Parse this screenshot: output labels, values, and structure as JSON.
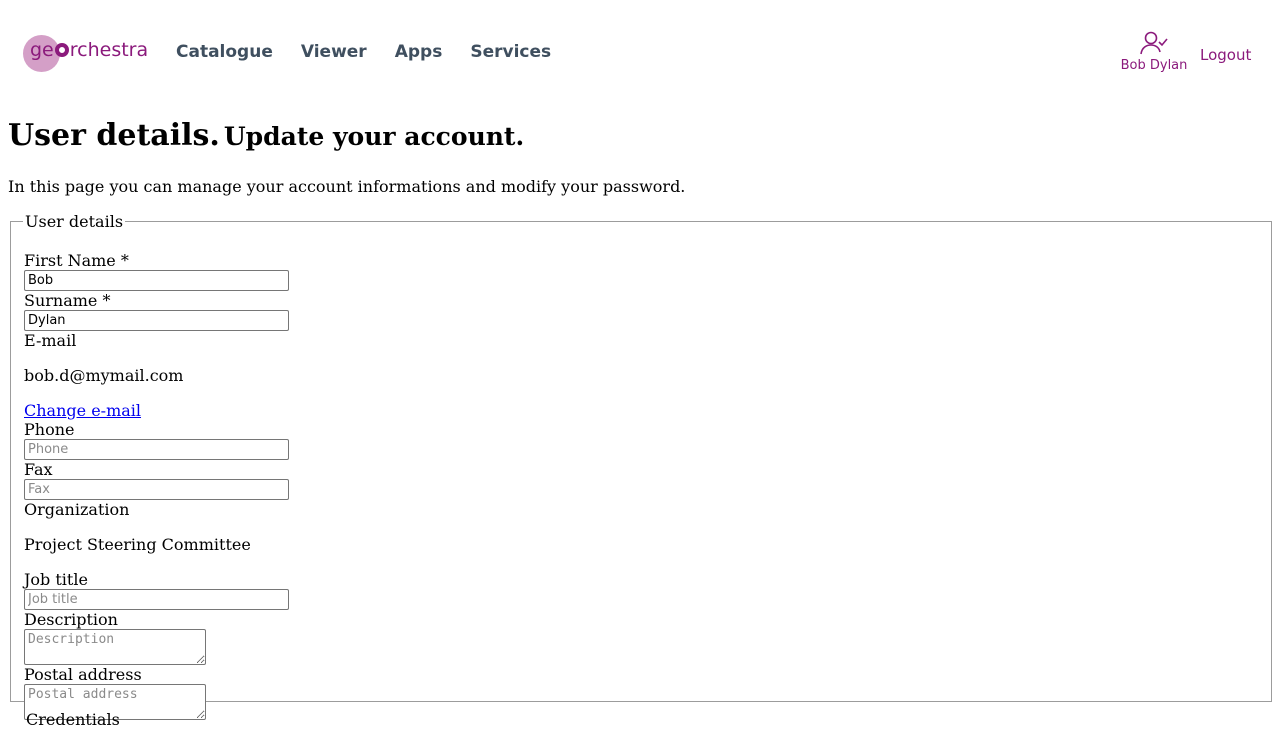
{
  "header": {
    "logo_text_pre": "ge",
    "logo_text_post": "rchestra",
    "nav": [
      "Catalogue",
      "Viewer",
      "Apps",
      "Services"
    ],
    "user_name": "Bob Dylan",
    "logout": "Logout"
  },
  "page": {
    "title": "User details.",
    "subtitle": "Update your account.",
    "intro": "In this page you can manage your account informations and modify your password."
  },
  "form": {
    "legend": "User details",
    "first_name_label": "First Name *",
    "first_name_value": "Bob",
    "surname_label": "Surname *",
    "surname_value": "Dylan",
    "email_label": "E-mail",
    "email_value": "bob.d@mymail.com",
    "change_email": "Change e-mail",
    "phone_label": "Phone",
    "phone_placeholder": "Phone",
    "fax_label": "Fax",
    "fax_placeholder": "Fax",
    "organization_label": "Organization",
    "organization_value": "Project Steering Committee",
    "job_title_label": "Job title",
    "job_title_placeholder": "Job title",
    "description_label": "Description",
    "description_placeholder": "Description",
    "postal_label": "Postal address",
    "postal_placeholder": "Postal address"
  },
  "next_section": {
    "legend": "Credentials"
  },
  "colors": {
    "brand": "#8b1a7c",
    "nav_text": "#3f4f5f",
    "link": "#0000ee"
  }
}
